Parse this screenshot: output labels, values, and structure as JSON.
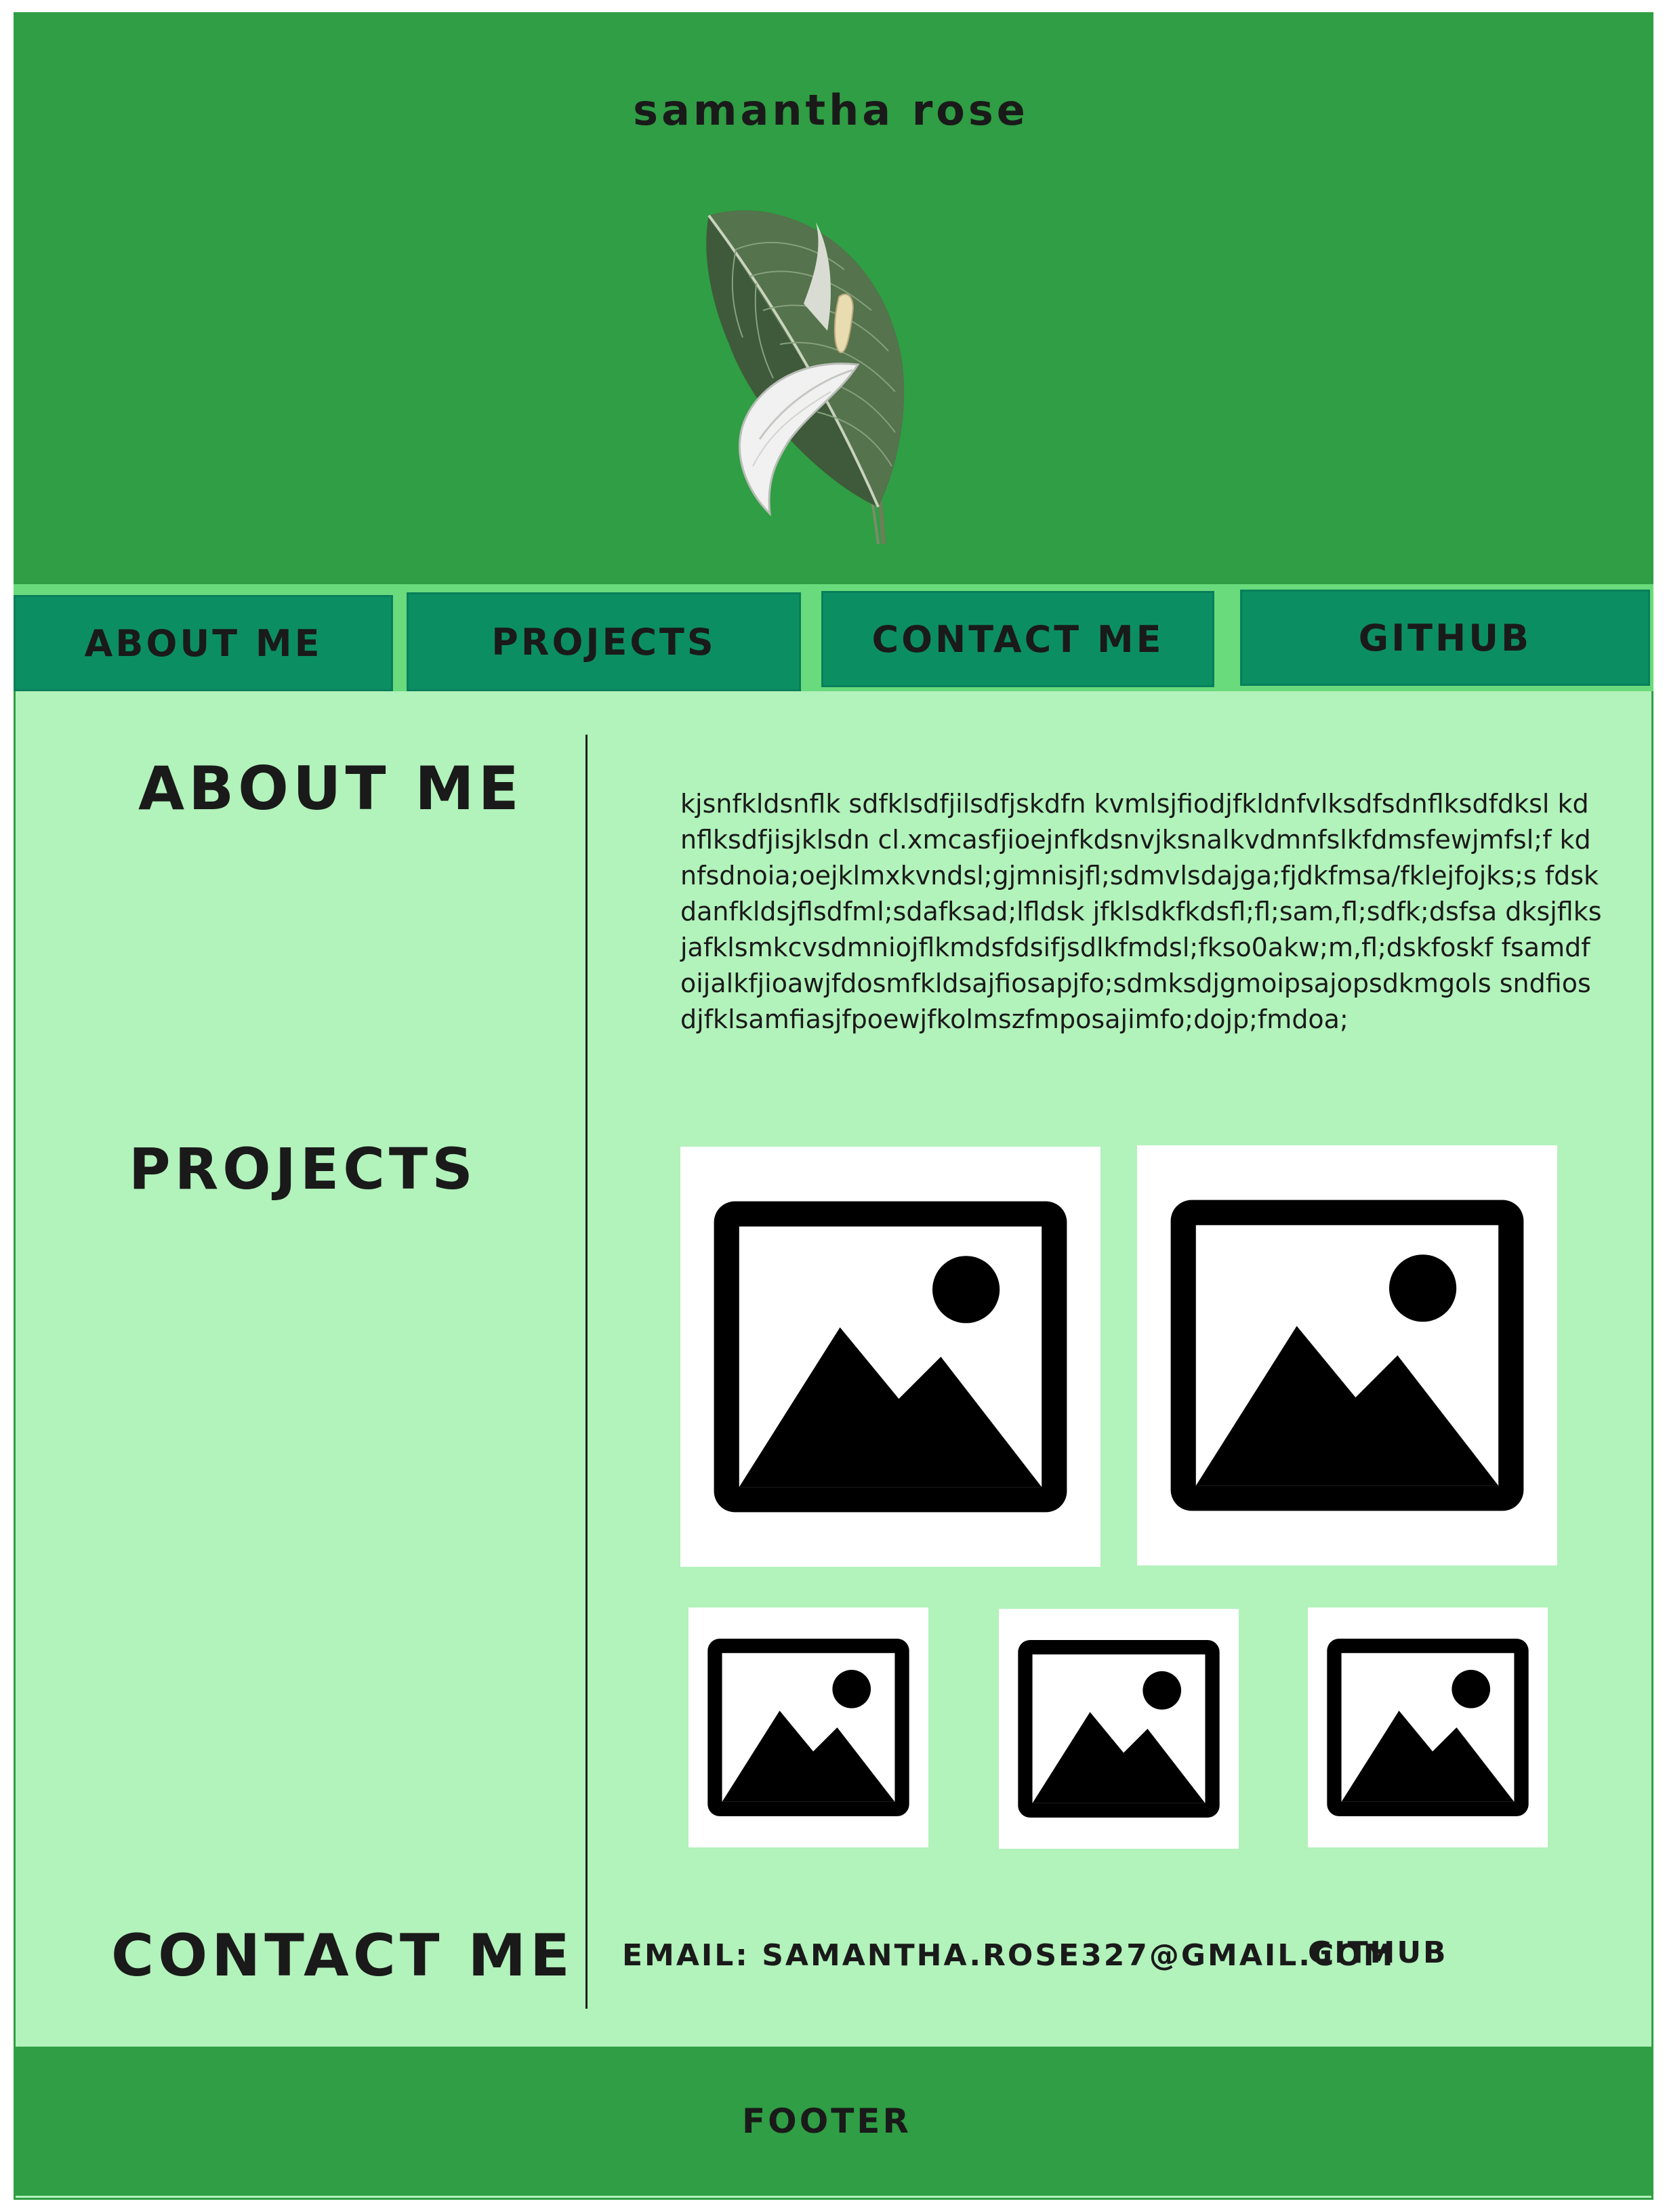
{
  "header": {
    "title": "samantha rose",
    "image_icon": "peace-lily-leaf-illustration"
  },
  "nav": {
    "items": [
      {
        "label": "ABOUT ME"
      },
      {
        "label": "PROJECTS"
      },
      {
        "label": "CONTACT ME"
      },
      {
        "label": "GITHUB"
      }
    ]
  },
  "sections": {
    "about_heading": "ABOUT ME",
    "about_text": "kjsnfkldsnflk sdfklsdfjilsdfjskdfn kvmlsjfiodjfkldnfvlksdfsdnflksdfdksl kdnflksdfjisjklsdn cl.xmcasfjioejnfkdsnvjksnalkvdmnfslkfdmsfewjmfsl;f kdnfsdnoia;oejklmxkvndsl;gjmnisjfl;sdmvlsdajga;fjdkfmsa/fklejfojks;s fdskdanfkldsjflsdfml;sdafksad;lfldsk jfklsdkfkdsfl;fl;sam,fl;sdfk;dsfsa dksjflksjafklsmkcvsdmniojflkmdsfdsifjsdlkfmdsl;fkso0akw;m,fl;dskfoskf fsamdfoijalkfjioawjfdosmfkldsajfiosapjfo;sdmksdjgmoipsajopsdkmgols sndfiosdjfklsamfiasjfpoewjfkolmszfmposajimfo;dojp;fmdoa;",
    "projects_heading": "PROJECTS",
    "project_icon": "image-placeholder-icon",
    "contact_heading": "CONTACT ME",
    "contact_email": "EMAIL: SAMANTHA.ROSE327@GMAIL.COM",
    "contact_github": "GITHUB"
  },
  "footer": {
    "label": "FOOTER"
  },
  "colors": {
    "header_green": "#2f9e44",
    "nav_button": "#0c8e63",
    "nav_bg": "#69db7c",
    "content_bg": "#b2f2bb"
  }
}
